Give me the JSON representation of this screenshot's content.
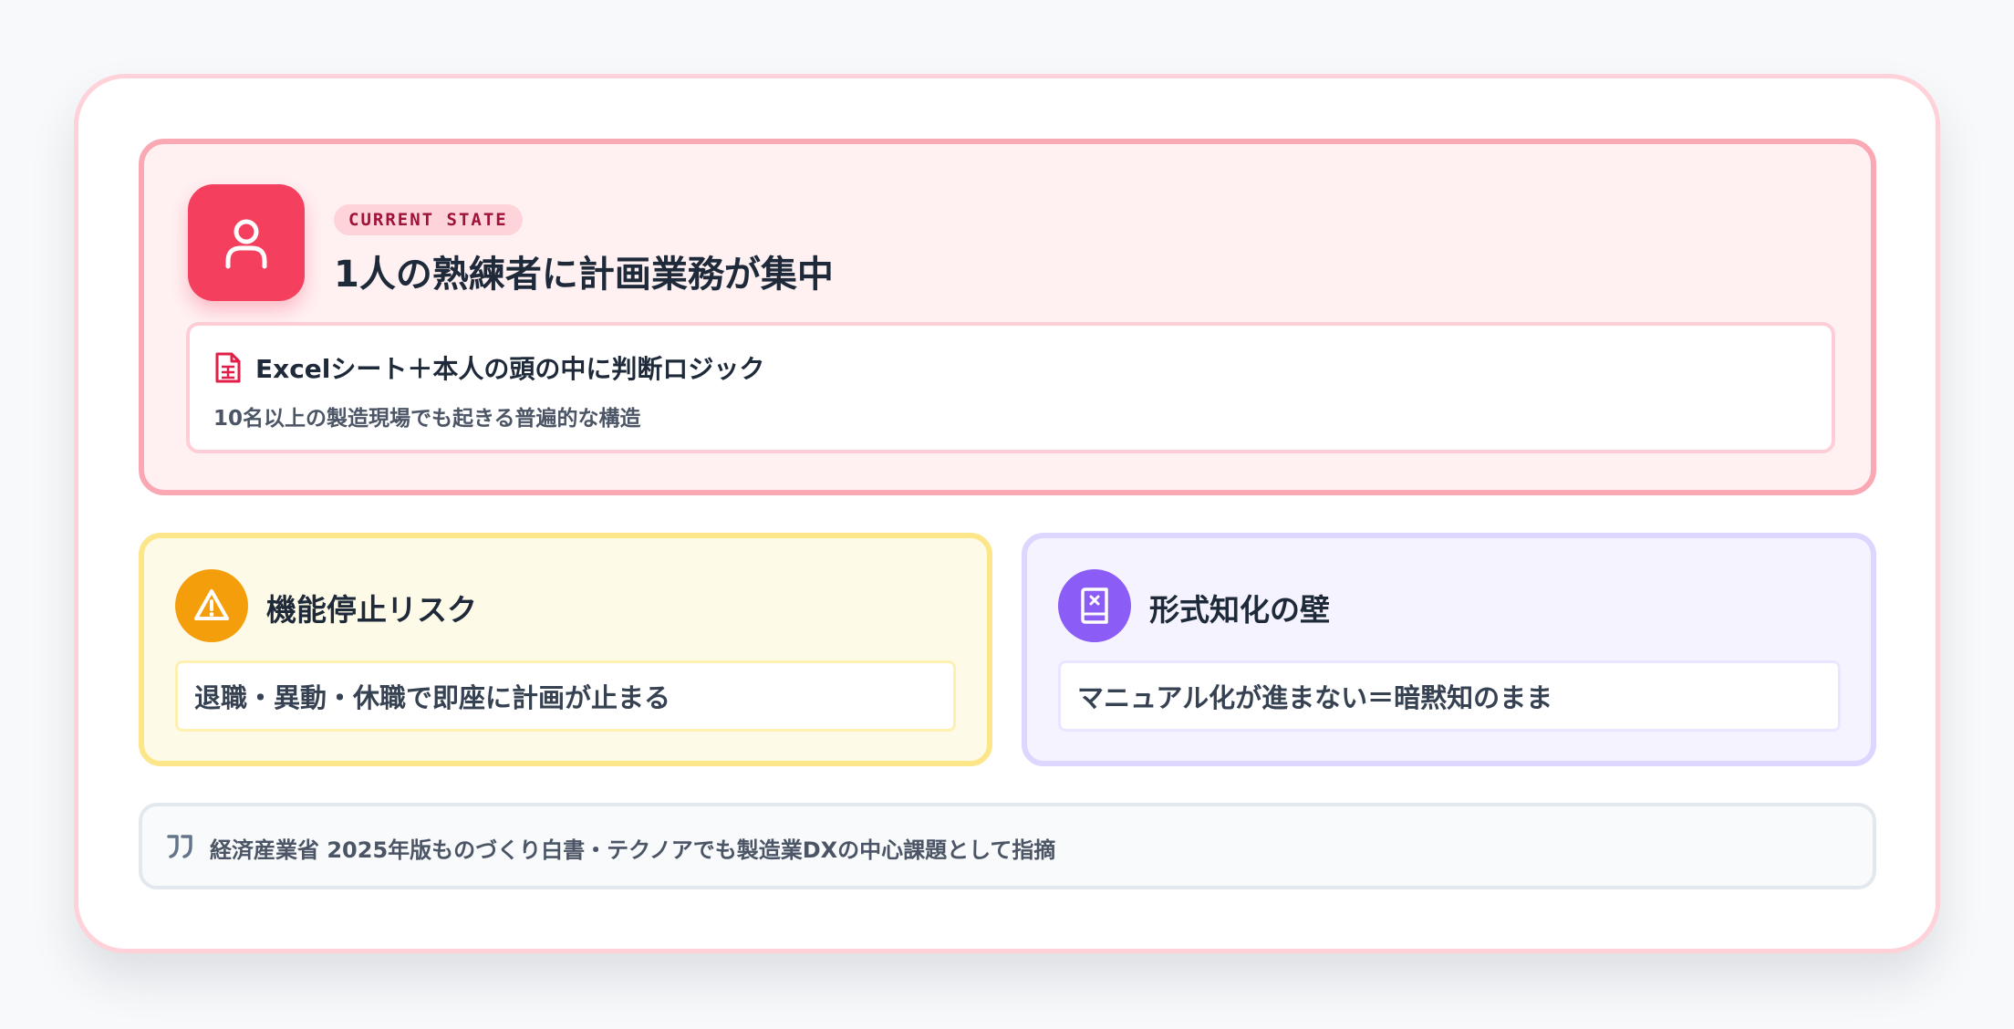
{
  "hero": {
    "badge": "CURRENT STATE",
    "title": "1人の熟練者に計画業務が集中",
    "detail_title": "Excelシート＋本人の頭の中に判断ロジック",
    "detail_sub": "10名以上の製造現場でも起きる普遍的な構造",
    "icon": "user-icon",
    "detail_icon": "spreadsheet-document-icon",
    "accent_color": "#f43f5e"
  },
  "cards": [
    {
      "title": "機能停止リスク",
      "text": "退職・異動・休職で即座に計画が止まる",
      "icon": "warning-triangle-icon",
      "accent_color": "#f59e0b"
    },
    {
      "title": "形式知化の壁",
      "text": "マニュアル化が進まない＝暗黙知のまま",
      "icon": "book-x-icon",
      "accent_color": "#8b5cf6"
    }
  ],
  "note": {
    "text": "経済産業省 2025年版ものづくり白書・テクノアでも製造業DXの中心課題として指摘",
    "icon": "quote-icon"
  }
}
